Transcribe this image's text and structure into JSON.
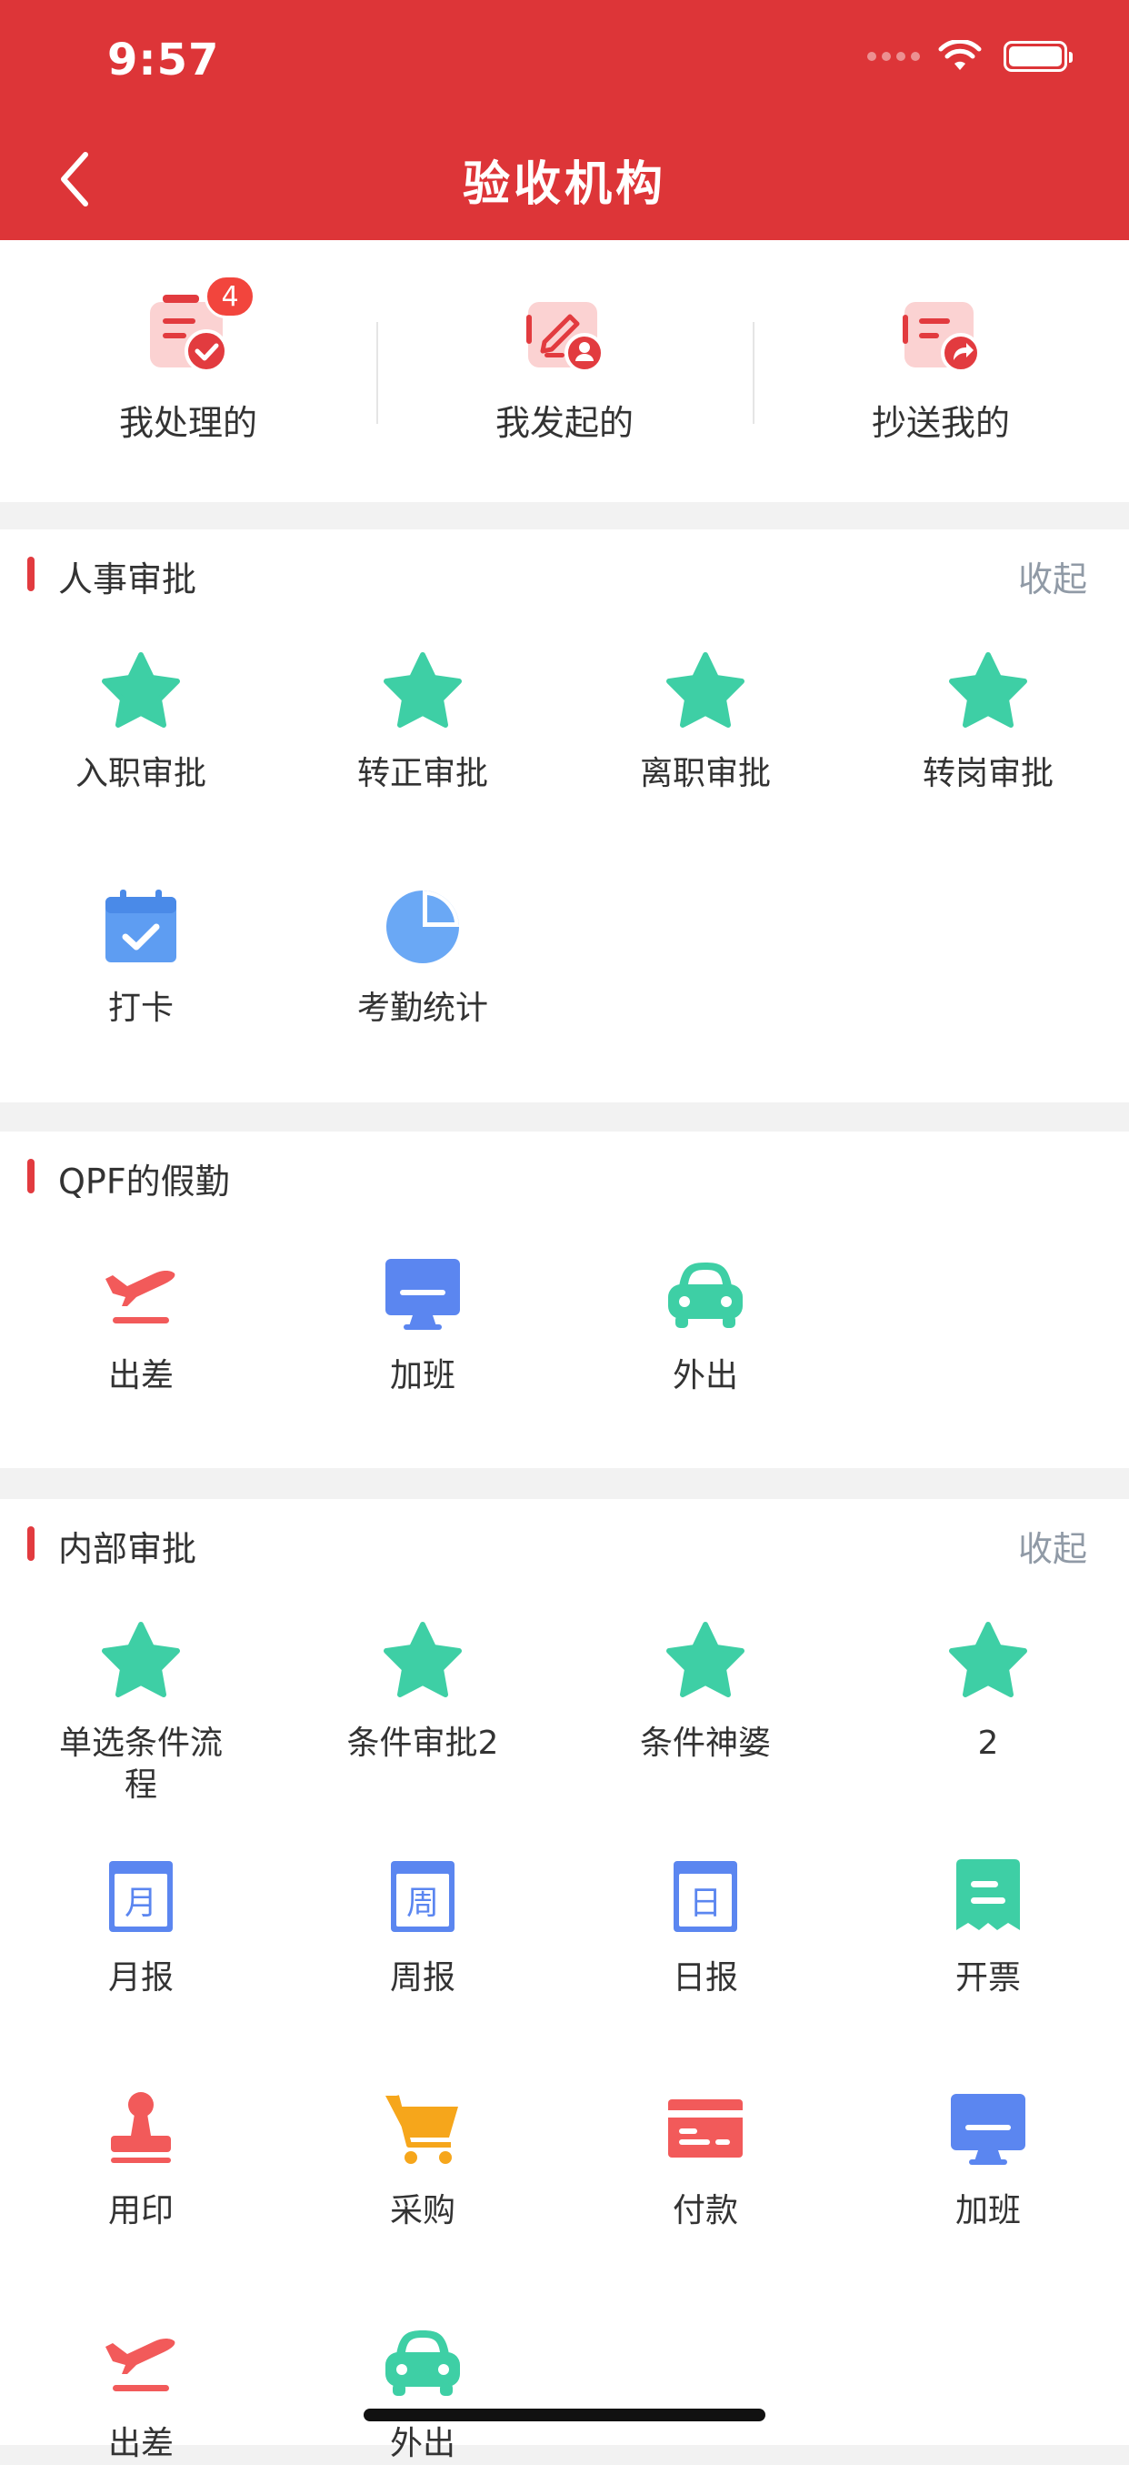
{
  "status_bar": {
    "time": "9:57"
  },
  "header": {
    "title": "验收机构"
  },
  "top_tabs": [
    {
      "label": "我处理的",
      "badge": "4"
    },
    {
      "label": "我发起的"
    },
    {
      "label": "抄送我的"
    }
  ],
  "sections": [
    {
      "title": "人事审批",
      "action": "收起",
      "items": [
        {
          "label": "入职审批",
          "icon": "star-icon"
        },
        {
          "label": "转正审批",
          "icon": "star-icon"
        },
        {
          "label": "离职审批",
          "icon": "star-icon"
        },
        {
          "label": "转岗审批",
          "icon": "star-icon"
        },
        {
          "label": "打卡",
          "icon": "calendar-check-icon"
        },
        {
          "label": "考勤统计",
          "icon": "pie-chart-icon"
        }
      ]
    },
    {
      "title": "QPF的假勤",
      "items": [
        {
          "label": "出差",
          "icon": "airplane-icon"
        },
        {
          "label": "加班",
          "icon": "monitor-icon"
        },
        {
          "label": "外出",
          "icon": "car-icon"
        }
      ]
    },
    {
      "title": "内部审批",
      "action": "收起",
      "items": [
        {
          "label": "单选条件流程",
          "icon": "star-icon"
        },
        {
          "label": "条件审批2",
          "icon": "star-icon"
        },
        {
          "label": "条件神婆",
          "icon": "star-icon"
        },
        {
          "label": "2",
          "icon": "star-icon"
        },
        {
          "label": "月报",
          "icon": "calendar-month-icon",
          "glyph": "月"
        },
        {
          "label": "周报",
          "icon": "calendar-week-icon",
          "glyph": "周"
        },
        {
          "label": "日报",
          "icon": "calendar-day-icon",
          "glyph": "日"
        },
        {
          "label": "开票",
          "icon": "receipt-icon"
        },
        {
          "label": "用印",
          "icon": "stamp-icon"
        },
        {
          "label": "采购",
          "icon": "shopping-cart-icon"
        },
        {
          "label": "付款",
          "icon": "credit-card-icon"
        },
        {
          "label": "加班",
          "icon": "monitor-icon"
        },
        {
          "label": "出差",
          "icon": "airplane-icon"
        },
        {
          "label": "外出",
          "icon": "car-icon"
        }
      ]
    }
  ],
  "colors": {
    "header_red": "#dd3538",
    "star_green": "#3ecfa5",
    "icon_blue": "#5b86f0",
    "icon_red": "#f25a5a",
    "icon_orange": "#f6a61b",
    "muted_action": "#909aa6"
  }
}
